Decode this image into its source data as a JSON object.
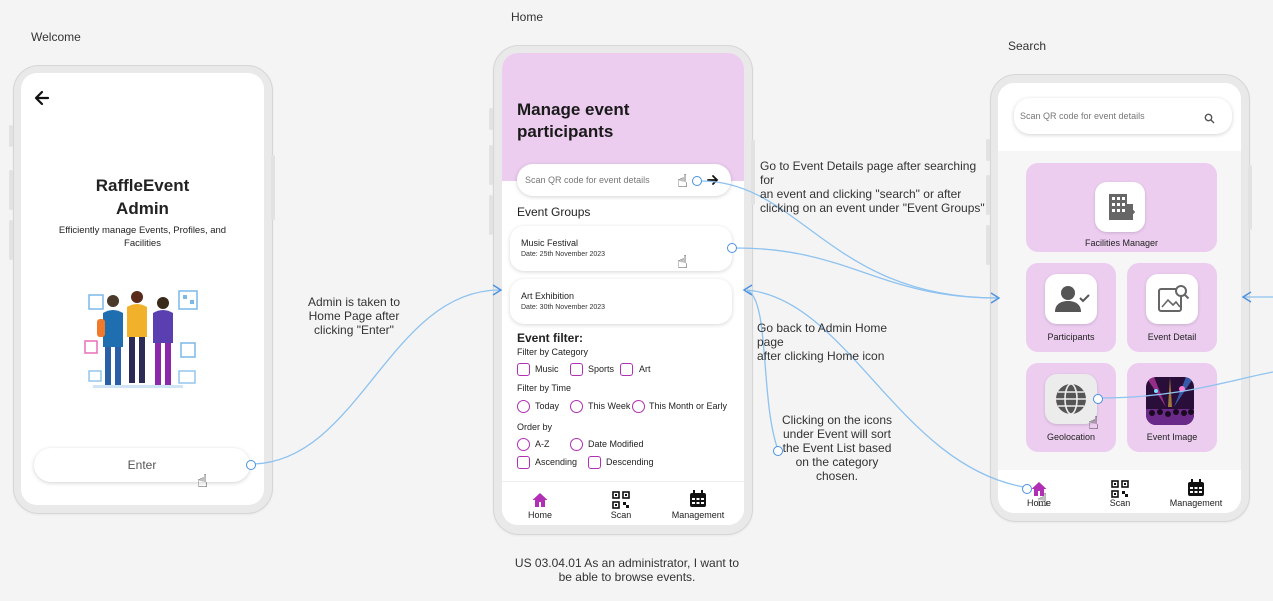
{
  "frames": {
    "welcome": {
      "label": "Welcome"
    },
    "home": {
      "label": "Home"
    },
    "search": {
      "label": "Search"
    }
  },
  "welcome": {
    "title_line1": "RaffleEvent",
    "title_line2": "Admin",
    "subtitle_line1": "Efficiently manage Events, Profiles, and",
    "subtitle_line2": "Facilities",
    "enter_label": "Enter",
    "icons": {
      "back": "arrow-left-icon",
      "illustration": "people-with-phones-illustration"
    }
  },
  "home": {
    "header_line1": "Manage event",
    "header_line2": "participants",
    "search_placeholder": "Scan QR code for event details",
    "event_groups_title": "Event Groups",
    "events": [
      {
        "name": "Music Festival",
        "date": "Date: 25th November 2023"
      },
      {
        "name": "Art Exhibition",
        "date": "Date: 30th November 2023"
      }
    ],
    "filter_title": "Event filter:",
    "filter_category_label": "Filter by Category",
    "categories": [
      "Music",
      "Sports",
      "Art"
    ],
    "filter_time_label": "Filter by Time",
    "times": [
      "Today",
      "This Week",
      "This Month or Early"
    ],
    "order_label": "Order by",
    "orders": [
      "A-Z",
      "Date Modified"
    ],
    "sort_dirs": [
      "Ascending",
      "Descending"
    ],
    "nav": [
      "Home",
      "Scan",
      "Management"
    ]
  },
  "search": {
    "search_placeholder": "Scan QR code for event details",
    "tiles": {
      "facilities": "Facilities Manager",
      "participants": "Participants",
      "event_detail": "Event Detail",
      "geolocation": "Geolocation",
      "event_image": "Event Image"
    },
    "nav": [
      "Home",
      "Scan",
      "Management"
    ]
  },
  "annotations": {
    "enter_flow": [
      "Admin is taken to",
      "Home Page after",
      "clicking \"Enter\""
    ],
    "details_flow": [
      "Go to Event Details page after searching for",
      "an event and clicking \"search\" or after",
      "clicking on an event under \"Event Groups\""
    ],
    "back_flow": [
      "Go back to Admin Home page",
      "after clicking Home icon"
    ],
    "filter_flow": [
      "Clicking on the icons",
      "under Event will sort",
      "the Event List based",
      "on the category",
      "chosen."
    ],
    "user_story": [
      "US 03.04.01 As an administrator, I want to",
      "be able to browse events."
    ]
  },
  "colors": {
    "accent": "#b02fb4",
    "pink": "#eccdf0",
    "connector": "#4a90e2"
  }
}
